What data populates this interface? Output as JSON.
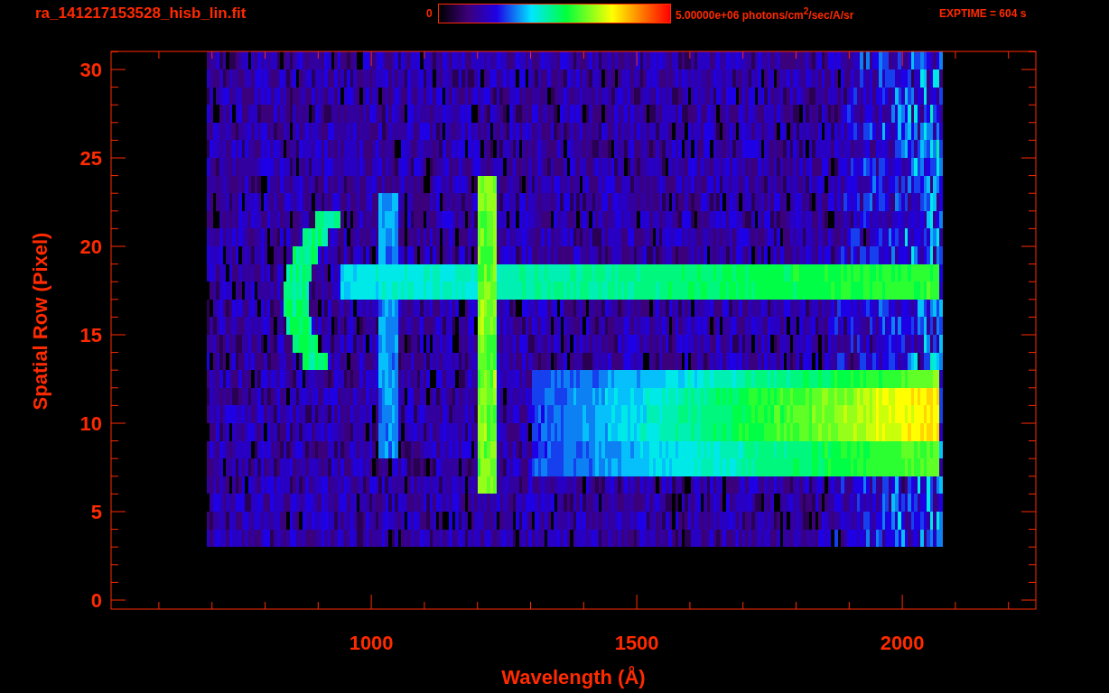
{
  "header": {
    "title": "ra_141217153528_hisb_lin.fit",
    "colorbar_min": "0",
    "colorbar_max": "5.00000e+06 photons/cm$^{2}$/sec/A/sr",
    "exposure": "EXPTIME = 604 s"
  },
  "x_axis": {
    "label": "Wavelength (Å)",
    "ticks": [
      "1000",
      "1500",
      "2000"
    ]
  },
  "y_axis": {
    "label": "Spatial Row (Pixel)",
    "ticks": [
      "30",
      "25",
      "20",
      "15",
      "10",
      "5",
      "0"
    ]
  }
}
